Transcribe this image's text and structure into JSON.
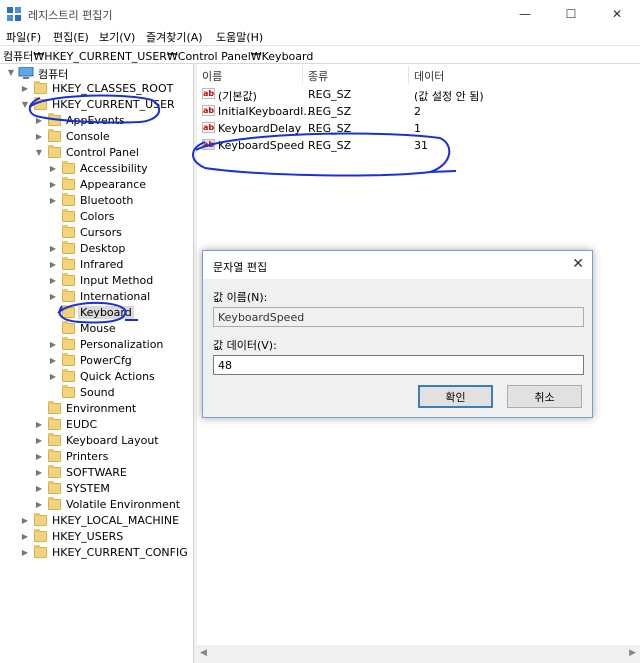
{
  "window": {
    "title": "레지스트리 편집기"
  },
  "menu": [
    "파일(F)",
    "편집(E)",
    "보기(V)",
    "즐겨찾기(A)",
    "도움말(H)"
  ],
  "address": "컴퓨터₩HKEY_CURRENT_USER₩Control Panel₩Keyboard",
  "tree": {
    "computer": "컴퓨터",
    "hkcr": "HKEY_CLASSES_ROOT",
    "hkcu": "HKEY_CURRENT_USER",
    "hkcu_children": [
      "AppEvents",
      "Console",
      "Control Panel"
    ],
    "control_panel_children": [
      "Accessibility",
      "Appearance",
      "Bluetooth",
      "Colors",
      "Cursors",
      "Desktop",
      "Infrared",
      "Input Method",
      "International",
      "Keyboard",
      "Mouse",
      "Personalization",
      "PowerCfg",
      "Quick Actions",
      "Sound"
    ],
    "hkcu_more": [
      "Environment",
      "EUDC",
      "Keyboard Layout",
      "Printers",
      "SOFTWARE",
      "SYSTEM",
      "Volatile Environment"
    ],
    "roots_more": [
      "HKEY_LOCAL_MACHINE",
      "HKEY_USERS",
      "HKEY_CURRENT_CONFIG"
    ]
  },
  "list": {
    "headers": {
      "name": "이름",
      "type": "종류",
      "data": "데이터"
    },
    "rows": [
      {
        "name": "(기본값)",
        "type": "REG_SZ",
        "data": "(값 설정 안 됨)"
      },
      {
        "name": "InitialKeyboardI...",
        "type": "REG_SZ",
        "data": "2"
      },
      {
        "name": "KeyboardDelay",
        "type": "REG_SZ",
        "data": "1"
      },
      {
        "name": "KeyboardSpeed",
        "type": "REG_SZ",
        "data": "31"
      }
    ]
  },
  "dialog": {
    "title": "문자열 편집",
    "name_label": "값 이름(N):",
    "name_value": "KeyboardSpeed",
    "data_label": "값 데이터(V):",
    "data_value": "48",
    "ok_label": "확인",
    "cancel_label": "취소"
  },
  "colors": {
    "annotation": "#1a2fd6",
    "folder": "#f3d27c",
    "selection": "#d9d9d9"
  }
}
